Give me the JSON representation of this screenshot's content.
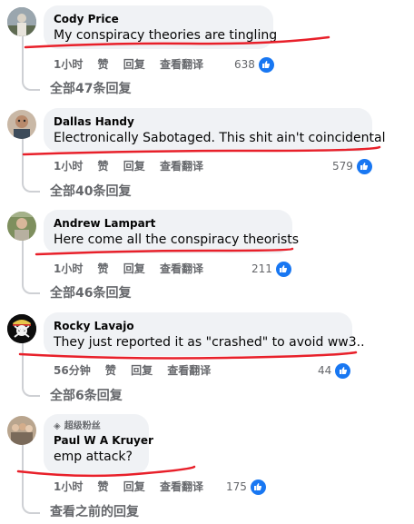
{
  "comments": [
    {
      "author": "Cody Price",
      "text": "My conspiracy theories are tingling",
      "time": "1小时",
      "like_label": "赞",
      "reply_label": "回复",
      "translate_label": "查看翻译",
      "reaction_count": "638",
      "replies_label": "全部47条回复"
    },
    {
      "author": "Dallas Handy",
      "text": "Electronically Sabotaged. This shit ain't coincidental",
      "time": "1小时",
      "like_label": "赞",
      "reply_label": "回复",
      "translate_label": "查看翻译",
      "reaction_count": "579",
      "replies_label": "全部40条回复"
    },
    {
      "author": "Andrew Lampart",
      "text": "Here come all the conspiracy theorists",
      "time": "1小时",
      "like_label": "赞",
      "reply_label": "回复",
      "translate_label": "查看翻译",
      "reaction_count": "211",
      "replies_label": "全部46条回复"
    },
    {
      "author": "Rocky Lavajo",
      "text": "They just reported it as \"crashed\" to avoid ww3..",
      "time": "56分钟",
      "like_label": "赞",
      "reply_label": "回复",
      "translate_label": "查看翻译",
      "reaction_count": "44",
      "replies_label": "全部6条回复"
    },
    {
      "badge": "超级粉丝",
      "author": "Paul W A Kruyer",
      "text": "emp attack?",
      "time": "1小时",
      "like_label": "赞",
      "reply_label": "回复",
      "translate_label": "查看翻译",
      "reaction_count": "175",
      "replies_label": "查看之前的回复"
    }
  ],
  "icons": {
    "like": "thumbs-up-icon",
    "badge": "diamond-icon"
  },
  "colors": {
    "bubble": "#f0f2f5",
    "meta_text": "#65676b",
    "like_blue": "#1877f2",
    "annotation_red": "#e8202a"
  }
}
